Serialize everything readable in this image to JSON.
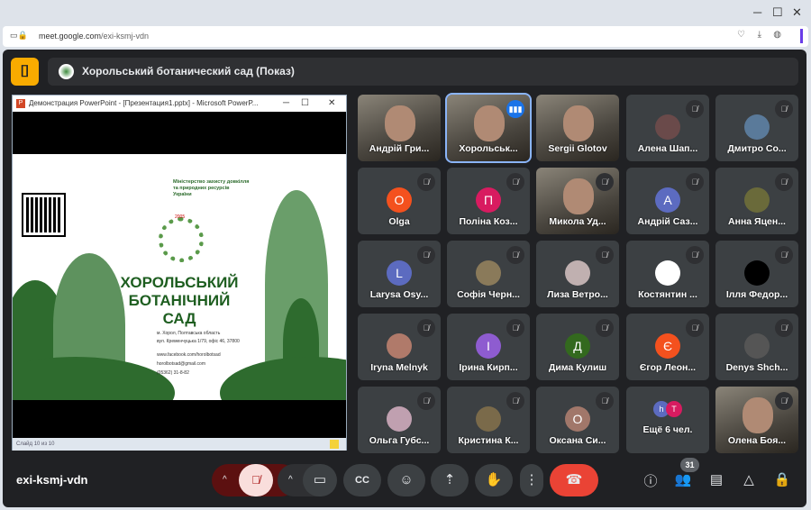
{
  "browser": {
    "url_host": "meet.google.com",
    "url_path": "/exi-ksmj-vdn",
    "window_controls": [
      "─",
      "☐",
      "✕"
    ]
  },
  "header": {
    "title": "Хорольський ботаничеcкий сад (Показ)"
  },
  "presentation": {
    "window_title": "Демонстрация PowerPoint - [Презентация1.pptx] - Microsoft PowerP...",
    "status": "Слайд 10 из 10",
    "slide": {
      "ministry": [
        "Міністерство захисту довкілля",
        "та природних ресурсів",
        "України"
      ],
      "title_lines": [
        "ХОРОЛЬСЬКИЙ",
        "БОТАНІЧНИЙ",
        "САД"
      ],
      "address": [
        "м. Хорол, Полтавська область",
        "вул. Кременчуцька 1/79, офіс 46, 37800"
      ],
      "facebook": "www.facebook.com/horolbotsad",
      "email": "horolbotsad@gmail.com",
      "phone": "(05362) 31-8-82",
      "year": "2005"
    }
  },
  "tiles": [
    {
      "name": "Андрій Гри...",
      "type": "video"
    },
    {
      "name": "Хорольськ...",
      "type": "video",
      "active": true
    },
    {
      "name": "Sergii Glotov",
      "type": "video"
    },
    {
      "name": "Алена Шап...",
      "type": "photo",
      "color": "#6a4a4a"
    },
    {
      "name": "Дмитро Со...",
      "type": "photo",
      "color": "#5a7a9a"
    },
    {
      "name": "Olga",
      "type": "initial",
      "letter": "O",
      "color": "#f4511e"
    },
    {
      "name": "Поліна Коз...",
      "type": "initial",
      "letter": "П",
      "color": "#d81b60"
    },
    {
      "name": "Микола Уд...",
      "type": "video",
      "muted": true
    },
    {
      "name": "Андрій Саз...",
      "type": "initial",
      "letter": "A",
      "color": "#5c6bc0"
    },
    {
      "name": "Анна Яцен...",
      "type": "photo",
      "color": "#6a6a3a"
    },
    {
      "name": "Larysa Osy...",
      "type": "initial",
      "letter": "L",
      "color": "#5c6bc0"
    },
    {
      "name": "Софія Черн...",
      "type": "photo",
      "color": "#8a7a5a"
    },
    {
      "name": "Лиза Ветро...",
      "type": "photo",
      "color": "#c0b0b0"
    },
    {
      "name": "Костянтин ...",
      "type": "photo",
      "color": "#ffffff"
    },
    {
      "name": "Ілля Федор...",
      "type": "photo",
      "color": "#000000"
    },
    {
      "name": "Iryna Melnyk",
      "type": "photo",
      "color": "#b07a6a"
    },
    {
      "name": "Ірина Кирп...",
      "type": "initial",
      "letter": "I",
      "color": "#8e5cd0"
    },
    {
      "name": "Дима Кулиш",
      "type": "initial",
      "letter": "Д",
      "color": "#33691e"
    },
    {
      "name": "Єгор Леон...",
      "type": "initial",
      "letter": "Є",
      "color": "#f4511e"
    },
    {
      "name": "Denys Shch...",
      "type": "photo",
      "color": "#555555"
    },
    {
      "name": "Ольга Губс...",
      "type": "photo",
      "color": "#c0a0b0"
    },
    {
      "name": "Кристина К...",
      "type": "photo",
      "color": "#7a6a4a"
    },
    {
      "name": "Оксана Си...",
      "type": "initial",
      "letter": "O",
      "color": "#a1776a"
    },
    {
      "name": "Ещё 6 чел.",
      "type": "more",
      "letters": [
        "h",
        "T"
      ],
      "colors": [
        "#5c6bc0",
        "#d81b60"
      ]
    },
    {
      "name": "Олена Боя...",
      "type": "video",
      "muted": true
    }
  ],
  "bottom": {
    "meeting_code": "exi-ksmj-vdn",
    "participants_count": "31"
  },
  "colors": {
    "bg": "#202124",
    "accent": "#f9ab00",
    "end_call": "#ea4335",
    "mic_off": "#f9dedc"
  }
}
